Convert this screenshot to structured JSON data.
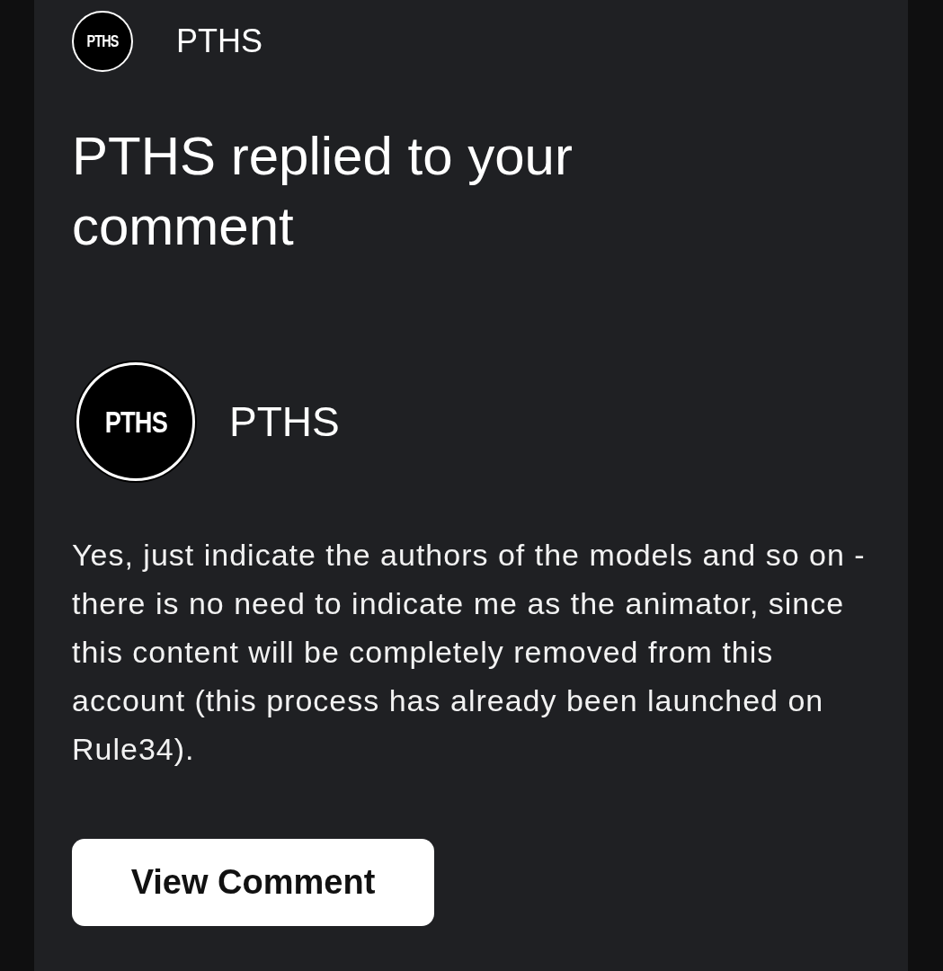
{
  "header": {
    "logo": "PTHS",
    "sender": "PTHS"
  },
  "title": "PTHS replied to your comment",
  "reply": {
    "avatar": "PTHS",
    "author": "PTHS",
    "text": "Yes, just indicate the authors of the models and so on - there is no need to indicate me as the animator, since this content will be completely removed from this account (this process has already been launched on Rule34)."
  },
  "button": "View Comment"
}
